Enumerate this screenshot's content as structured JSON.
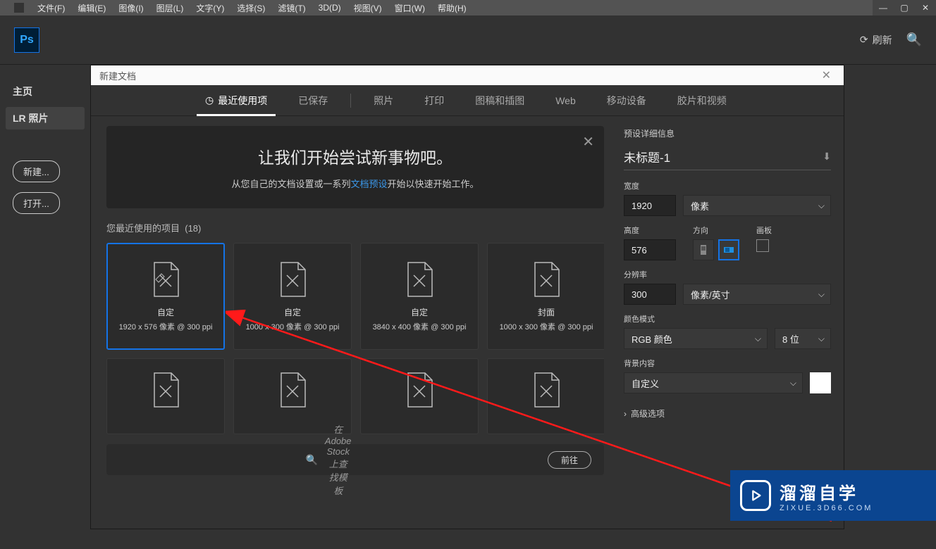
{
  "menubar": {
    "items": [
      "文件(F)",
      "编辑(E)",
      "图像(I)",
      "图层(L)",
      "文字(Y)",
      "选择(S)",
      "滤镜(T)",
      "3D(D)",
      "视图(V)",
      "窗口(W)",
      "帮助(H)"
    ]
  },
  "ps_logo_text": "Ps",
  "refresh_label": "刷新",
  "leftbar": {
    "home": "主页",
    "lr": "LR 照片",
    "new_btn": "新建...",
    "open_btn": "打开..."
  },
  "modal": {
    "title": "新建文档",
    "tabs": [
      "最近使用项",
      "已保存",
      "照片",
      "打印",
      "图稿和插图",
      "Web",
      "移动设备",
      "胶片和视频"
    ],
    "banner": {
      "heading": "让我们开始尝试新事物吧。",
      "text_before": "从您自己的文档设置或一系列",
      "link": "文档预设",
      "text_after": "开始以快速开始工作。"
    },
    "recent_label": "您最近使用的项目",
    "recent_count": "(18)",
    "presets": [
      {
        "name": "自定",
        "dim": "1920 x 576 像素 @ 300 ppi"
      },
      {
        "name": "自定",
        "dim": "1000 x 300 像素 @ 300 ppi"
      },
      {
        "name": "自定",
        "dim": "3840 x 400 像素 @ 300 ppi"
      },
      {
        "name": "封面",
        "dim": "1000 x 300 像素 @ 300 ppi"
      }
    ],
    "stock": {
      "placeholder": "在 Adobe Stock 上查找模板",
      "go": "前往"
    }
  },
  "details": {
    "section_title": "预设详细信息",
    "doc_name": "未标题-1",
    "width_label": "宽度",
    "width_value": "1920",
    "unit": "像素",
    "height_label": "高度",
    "height_value": "576",
    "orient_label": "方向",
    "artboard_label": "画板",
    "res_label": "分辨率",
    "res_value": "300",
    "res_unit": "像素/英寸",
    "color_label": "颜色模式",
    "color_mode": "RGB 颜色",
    "bit_depth": "8 位",
    "bg_label": "背景内容",
    "bg_value": "自定义",
    "advanced": "高级选项"
  },
  "watermark": {
    "big": "溜溜自学",
    "small": "ZIXUE.3D66.COM"
  }
}
